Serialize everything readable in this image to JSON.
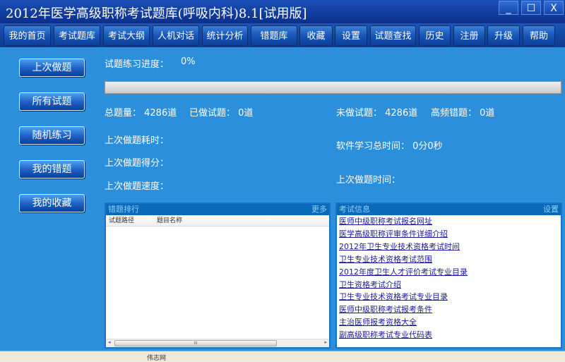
{
  "window": {
    "title": "2012年医学高级职称考试题库(呼吸内科)8.1[试用版]",
    "minimize": "_",
    "maximize": "☐",
    "close": "X"
  },
  "nav": [
    "我的首页",
    "考试题库",
    "考试大纲",
    "人机对话",
    "统计分析",
    "错题库",
    "收藏",
    "设置",
    "试题查找",
    "历史",
    "注册",
    "升级",
    "帮助"
  ],
  "side": [
    "上次做题",
    "所有试题",
    "随机练习",
    "我的错题",
    "我的收藏"
  ],
  "stats": {
    "progress_label": "试题练习进度：",
    "progress_value": "0%",
    "progress_fraction": 0,
    "total": "总题量：  4286道",
    "done": "已做试题：  0道",
    "undone": "未做试题：  4286道",
    "frequent_wrong": "高频错题：  0道",
    "last_time_spent": "上次做题耗时：",
    "last_score": "上次做题得分：",
    "last_speed": "上次做题速度：",
    "total_study_time": "软件学习总时间：  0分0秒",
    "last_time": "上次做题时间："
  },
  "left_panel": {
    "title": "错题排行",
    "more": "更多",
    "col1": "试题路径",
    "col2": "题目名称",
    "scroll_thumb": "III"
  },
  "right_panel": {
    "title": "考试信息",
    "settings": "设置",
    "links": [
      "医师中级职称考试报名网址",
      "医学高级职称评审条件详细介绍",
      "2012年卫生专业技术资格考试时间",
      "卫生专业技术资格考试范围",
      "2012年度卫生人才评价考试专业目录",
      "卫生资格考试介绍",
      "卫生专业技术资格考试专业目录",
      "医师中级职称考试报考条件",
      "主治医师报考资格大全",
      "副高级职称考试专业代码表"
    ]
  },
  "status": {
    "text": "伟志网"
  }
}
